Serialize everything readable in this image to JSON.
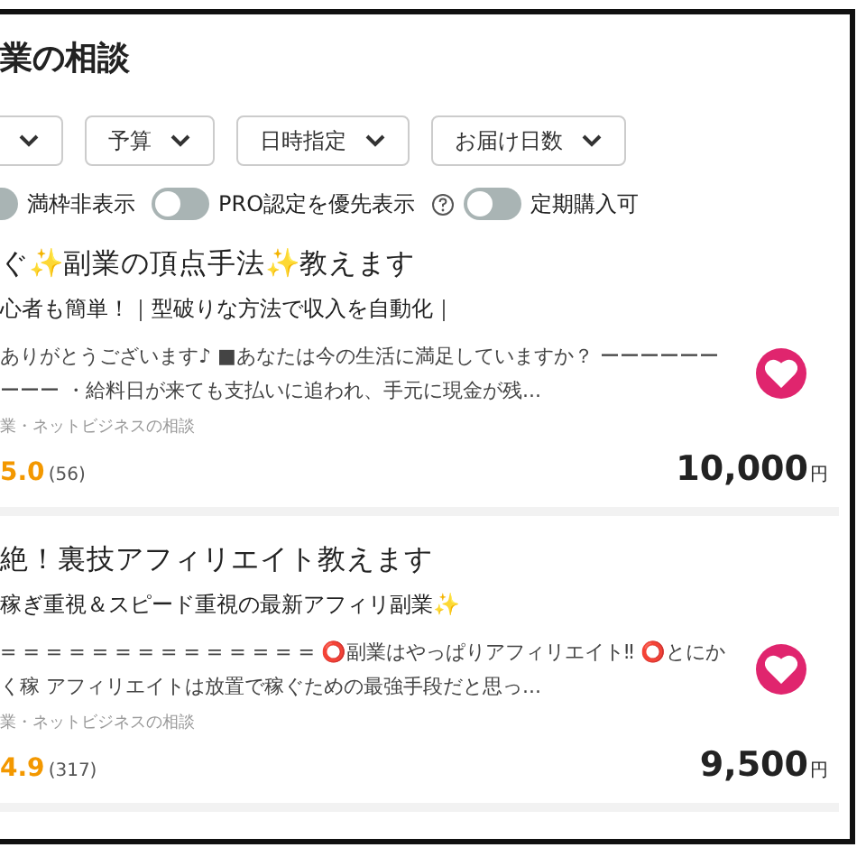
{
  "page": {
    "title": "業の相談"
  },
  "filters": [
    {
      "kind": "cut"
    },
    {
      "kind": "full",
      "label": "予算"
    },
    {
      "kind": "full",
      "label": "日時指定"
    },
    {
      "kind": "full",
      "label": "お届け日数"
    }
  ],
  "toggles": [
    {
      "label": "満枠非表示",
      "on": false
    },
    {
      "label": "PRO認定を優先表示",
      "on": false,
      "help": true
    },
    {
      "label": "定期購入可",
      "on": false
    }
  ],
  "services": [
    {
      "title": "ぐ✨副業の頂点手法✨教えます",
      "subtitle": "心者も簡単！｜型破りな方法で収入を自動化｜",
      "description": "ありがとうございます♪ ■あなたは今の生活に満足していますか？ ーーーーーーーーー ・給料日が来ても支払いに追われ、手元に現金が残...",
      "category": "業・ネットビジネスの相談",
      "rating": "5.0",
      "reviews": "(56)",
      "price": "10,000",
      "currency": "円",
      "favorited": true
    },
    {
      "title": "絶！裏技アフィリエイト教えます",
      "subtitle": "稼ぎ重視＆スピード重視の最新アフィリ副業✨",
      "description": "= = = = = = = = = = = = = = ⭕副業はやっぱりアフィリエイト‼ ⭕とにかく稼 アフィリエイトは放置で稼ぐための最強手段だと思っ...",
      "category": "業・ネットビジネスの相談",
      "rating": "4.9",
      "reviews": "(317)",
      "price": "9,500",
      "currency": "円",
      "favorited": true
    }
  ]
}
